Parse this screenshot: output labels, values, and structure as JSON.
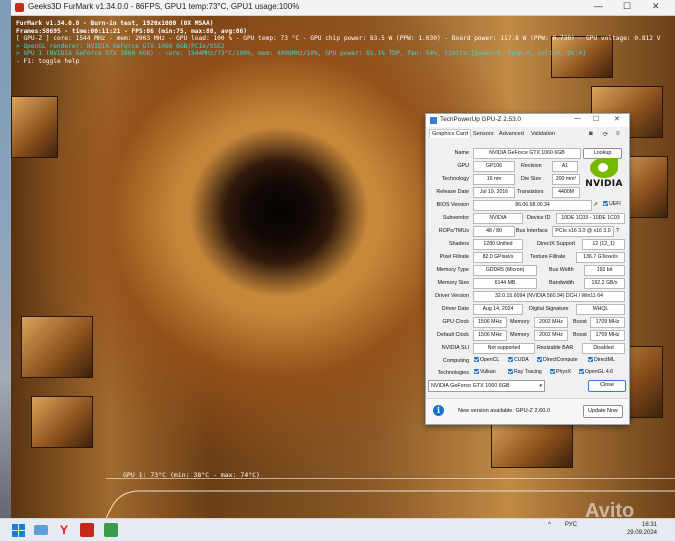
{
  "furmark": {
    "title": "Geeks3D FurMark v1.34.0.0 - 86FPS, GPU1 temp:73°C, GPU1 usage:100%",
    "osd": [
      "FurMark v1.34.0.8 - Burn-in test, 1920x1080 (0X MSAA)",
      "Frames:58695 - time:00:11:21 - FPS:86 (min:75, max:88, avg:86)",
      "[ GPU-Z ] core: 1544 MHz - mem: 2003 MHz - GPU load: 100 % - GPU temp: 73 °C - GPU chip power: 83.5 W (PPW: 1.030) - Board power: 117.8 W (PPW: 0.730) - GPU voltage: 0.812 V",
      "> OpenGL renderer: NVIDIA GeForce GTX 1060 6GB/PCIe/SSE2",
      "> GPU 1 (NVIDIA GeForce GTX 1060 6GB) - core: 1544MHz/73°C/100%, mem: 4006MHz/10%, GPU power: 85.1% TDP, fan: 54%, limits:[power:0, temp:0, volt:0, OV:0]",
      "- F1: toggle help"
    ],
    "temp_label": "GPU 1: 73°C (min: 38°C - max: 74°C)"
  },
  "gpuz": {
    "title": "TechPowerUp GPU-Z 2.53.0",
    "tabs": [
      "Graphics Card",
      "Sensors",
      "Advanced",
      "Validation"
    ],
    "name_label": "Name",
    "name": "NVIDIA GeForce GTX 1060 6GB",
    "lookup": "Lookup",
    "gpu_label": "GPU",
    "gpu": "GP106",
    "revision_label": "Revision",
    "revision": "A1",
    "technology_label": "Technology",
    "technology": "16 nm",
    "die_size_label": "Die Size",
    "die_size": "200 mm²",
    "release_label": "Release Date",
    "release": "Jul 19, 2016",
    "transistors_label": "Transistors",
    "transistors": "4400M",
    "bios_label": "BIOS Version",
    "bios": "86.06.68.00.34",
    "uefi": "UEFI",
    "subvendor_label": "Subvendor",
    "subvendor": "NVIDIA",
    "device_id_label": "Device ID",
    "device_id": "10DE 1C03 - 10DE 1C03",
    "rops_label": "ROPs/TMUs",
    "rops": "48 / 80",
    "bus_label": "Bus Interface",
    "bus": "PCIe x16 3.0 @ x16 3.0",
    "help": "?",
    "shaders_label": "Shaders",
    "shaders": "1280 Unified",
    "dx_label": "DirectX Support",
    "dx": "12 (12_1)",
    "pixel_label": "Pixel Fillrate",
    "pixel": "82.0 GPixel/s",
    "texture_label": "Texture Fillrate",
    "texture": "136.7 GTexel/s",
    "memtype_label": "Memory Type",
    "memtype": "GDDR5 (Micron)",
    "buswidth_label": "Bus Width",
    "buswidth": "192 bit",
    "memsize_label": "Memory Size",
    "memsize": "6144 MB",
    "bandwidth_label": "Bandwidth",
    "bandwidth": "192.2 GB/s",
    "driver_label": "Driver Version",
    "driver": "32.0.15.6094 (NVIDIA 560.94) DCH / Win11 64",
    "driverdate_label": "Driver Date",
    "driverdate": "Aug 14, 2024",
    "sig_label": "Digital Signature",
    "sig": "WHQL",
    "gpuclock_label": "GPU Clock",
    "gpuclock": "1506 MHz",
    "mem_label": "Memory",
    "memclock": "2002 MHz",
    "boost_label": "Boost",
    "boost": "1709 MHz",
    "defclock_label": "Default Clock",
    "defclock": "1506 MHz",
    "defmem": "2002 MHz",
    "defboost": "1709 MHz",
    "sli_label": "NVIDIA SLI",
    "sli": "Not supported",
    "rebar_label": "Resizable BAR",
    "rebar": "Disabled",
    "computing_label": "Computing",
    "computing": [
      "OpenCL",
      "CUDA",
      "DirectCompute",
      "DirectML"
    ],
    "tech_label": "Technologies",
    "technologies": [
      "Vulkan",
      "Ray Tracing",
      "PhysX",
      "OpenGL 4.6"
    ],
    "selected_gpu": "NVIDIA GeForce GTX 1060 6GB",
    "close": "Close",
    "nvidia_logo": "NVIDIA",
    "update_text": "New version available: GPU-Z 2.60.0",
    "update_btn": "Update Now"
  },
  "taskbar": {
    "tray_lang": "РУС",
    "time": "16:31",
    "date": "29.09.2024"
  },
  "watermark": "Avito"
}
